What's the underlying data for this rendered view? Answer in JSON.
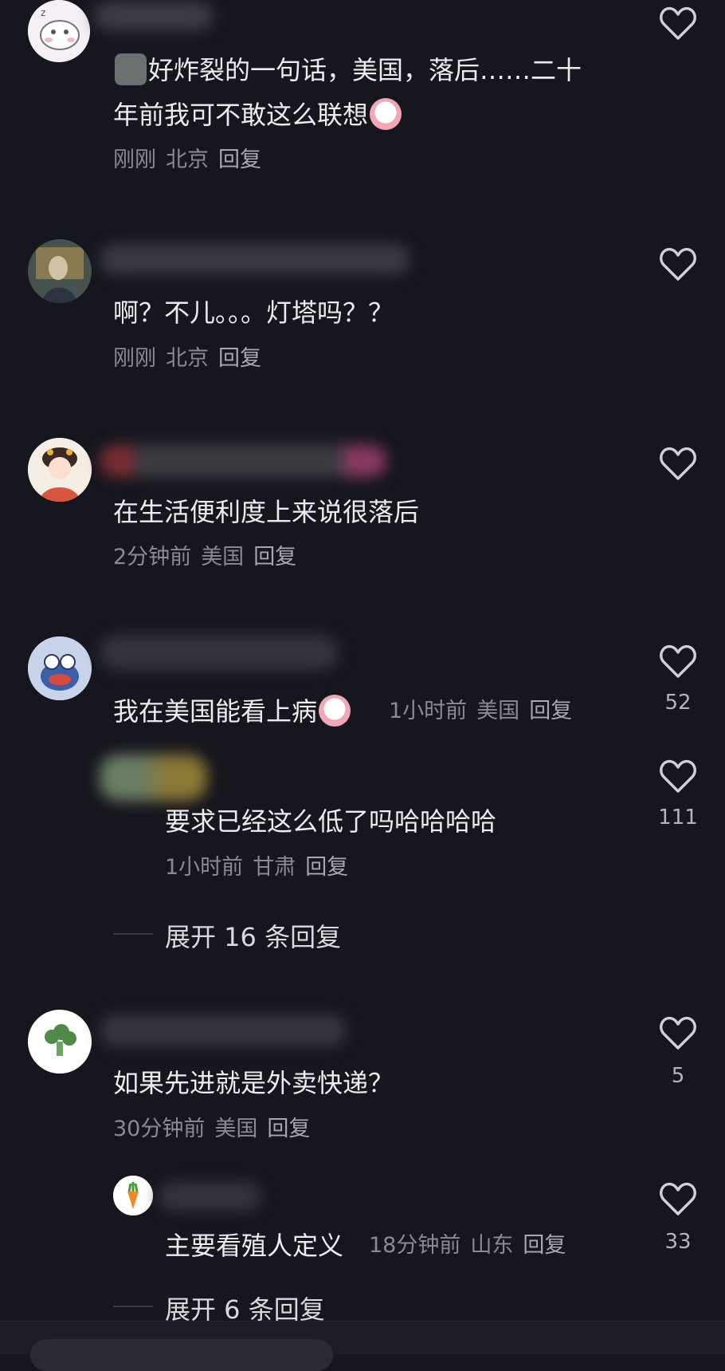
{
  "reply_label": "回复",
  "comments": [
    {
      "text_line1": "好炸裂的一句话，美国，落后……二十",
      "text_line2": "年前我可不敢这么联想",
      "time": "刚刚",
      "location": "北京",
      "reply": "回复"
    },
    {
      "text": "啊？不儿。。。灯塔吗？？",
      "time": "刚刚",
      "location": "北京",
      "reply": "回复"
    },
    {
      "text": "在生活便利度上来说很落后",
      "time": "2分钟前",
      "location": "美国",
      "reply": "回复"
    },
    {
      "text": "我在美国能看上病",
      "time": "1小时前",
      "location": "美国",
      "reply": "回复",
      "likes": "52",
      "sub_reply": {
        "text": "要求已经这么低了吗哈哈哈哈",
        "time": "1小时前",
        "location": "甘肃",
        "reply": "回复",
        "likes": "111"
      },
      "expand": "展开 16 条回复"
    },
    {
      "text": "如果先进就是外卖快递？",
      "time": "30分钟前",
      "location": "美国",
      "reply": "回复",
      "likes": "5",
      "sub_reply": {
        "text": "主要看殖人定义",
        "time": "18分钟前",
        "location": "山东",
        "reply": "回复",
        "likes": "33"
      },
      "expand": "展开 6 条回复"
    }
  ],
  "colors": {
    "background": "#16161e",
    "text": "#ececf0",
    "meta": "#8a8a93",
    "heart_outline": "#d0d0d6"
  }
}
